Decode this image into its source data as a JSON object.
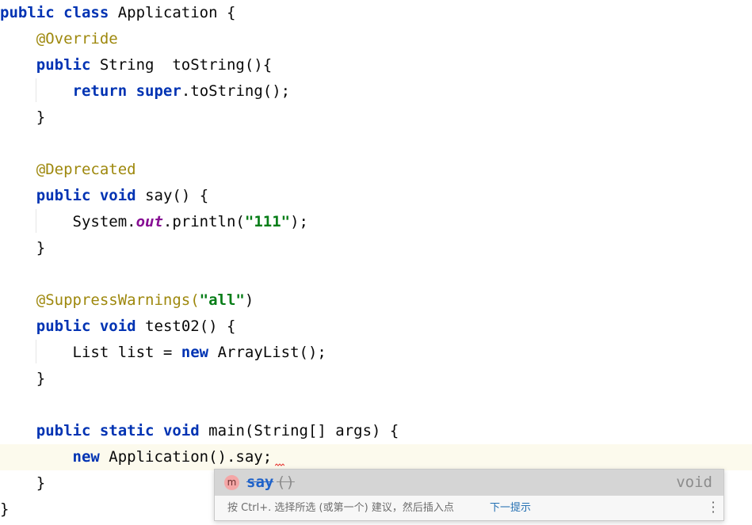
{
  "code": {
    "kw_public": "public",
    "kw_class": "class",
    "class_name": " Application {",
    "ann_override": "@Override",
    "type_string": " String  toString(){",
    "kw_return": "return",
    "kw_super": "super",
    "tostring_call": ".toString();",
    "close_brace": "}",
    "ann_deprecated": "@Deprecated",
    "kw_void": "void",
    "say_decl": " say() {",
    "system": "System.",
    "out": "out",
    "println_open": ".println(",
    "str_111": "\"111\"",
    "stmt_end": ");",
    "ann_suppress": "@SuppressWarnings(",
    "str_all": "\"all\"",
    "paren_close": ")",
    "test02_decl": " test02() {",
    "list_decl": "List list = ",
    "kw_new": "new",
    "arraylist": " ArrayList();",
    "kw_static": "static",
    "main_decl": " main(String[] args) {",
    "new_app_call": " Application().say;"
  },
  "completion": {
    "icon_letter": "m",
    "item_name": "say",
    "item_params": "()",
    "item_type": "void",
    "hint": "按 Ctrl+. 选择所选 (或第一个) 建议，然后插入点",
    "next_tip": "下一提示"
  },
  "colors": {
    "keyword": "#0033b3",
    "annotation": "#9e880d",
    "string": "#067d17",
    "field": "#871094",
    "current_line": "#fcfaed"
  }
}
